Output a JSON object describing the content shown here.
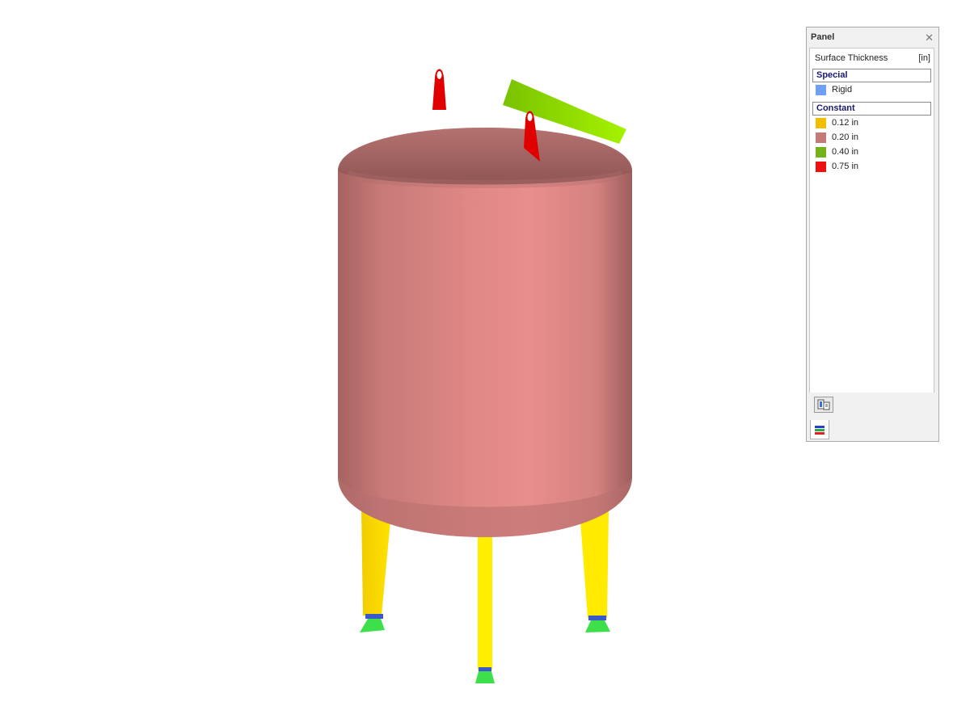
{
  "panel": {
    "title": "Panel",
    "close_glyph": "✕",
    "legend_title": "Surface Thickness",
    "unit": "[in]",
    "groups": [
      {
        "header": "Special",
        "items": [
          {
            "label": "Rigid",
            "color": "#6f9ff5"
          }
        ]
      },
      {
        "header": "Constant",
        "items": [
          {
            "label": "0.12 in",
            "color": "#f0c000"
          },
          {
            "label": "0.20 in",
            "color": "#c47a78"
          },
          {
            "label": "0.40 in",
            "color": "#74b21a"
          },
          {
            "label": "0.75 in",
            "color": "#ee1111"
          }
        ]
      }
    ],
    "footer_button_icon": "display-options-icon",
    "tab_icon": "color-legend-icon"
  },
  "model": {
    "shell_color": "#e08a88",
    "nozzle_color": "#8ee000",
    "lug_color": "#e00000",
    "leg_color": "#ffe800",
    "support_color": "#3de04a"
  }
}
